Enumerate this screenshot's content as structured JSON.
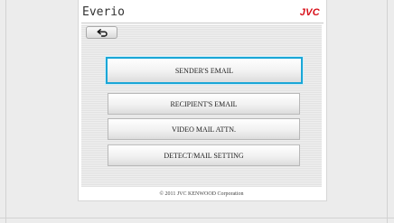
{
  "app": {
    "title": "Everio",
    "brand": "JVC",
    "brand_color": "#d8101a"
  },
  "toolbar": {
    "back_icon": "return-arrow-icon"
  },
  "menu": {
    "items": [
      {
        "label": "SENDER'S EMAIL",
        "selected": true
      },
      {
        "label": "RECIPIENT'S EMAIL",
        "selected": false
      },
      {
        "label": "VIDEO MAIL ATTN.",
        "selected": false
      },
      {
        "label": "DETECT/MAIL SETTING",
        "selected": false
      }
    ],
    "selection_color": "#1aa6d6"
  },
  "footer": {
    "copyright": "© 2011 JVC KENWOOD Corporation"
  }
}
